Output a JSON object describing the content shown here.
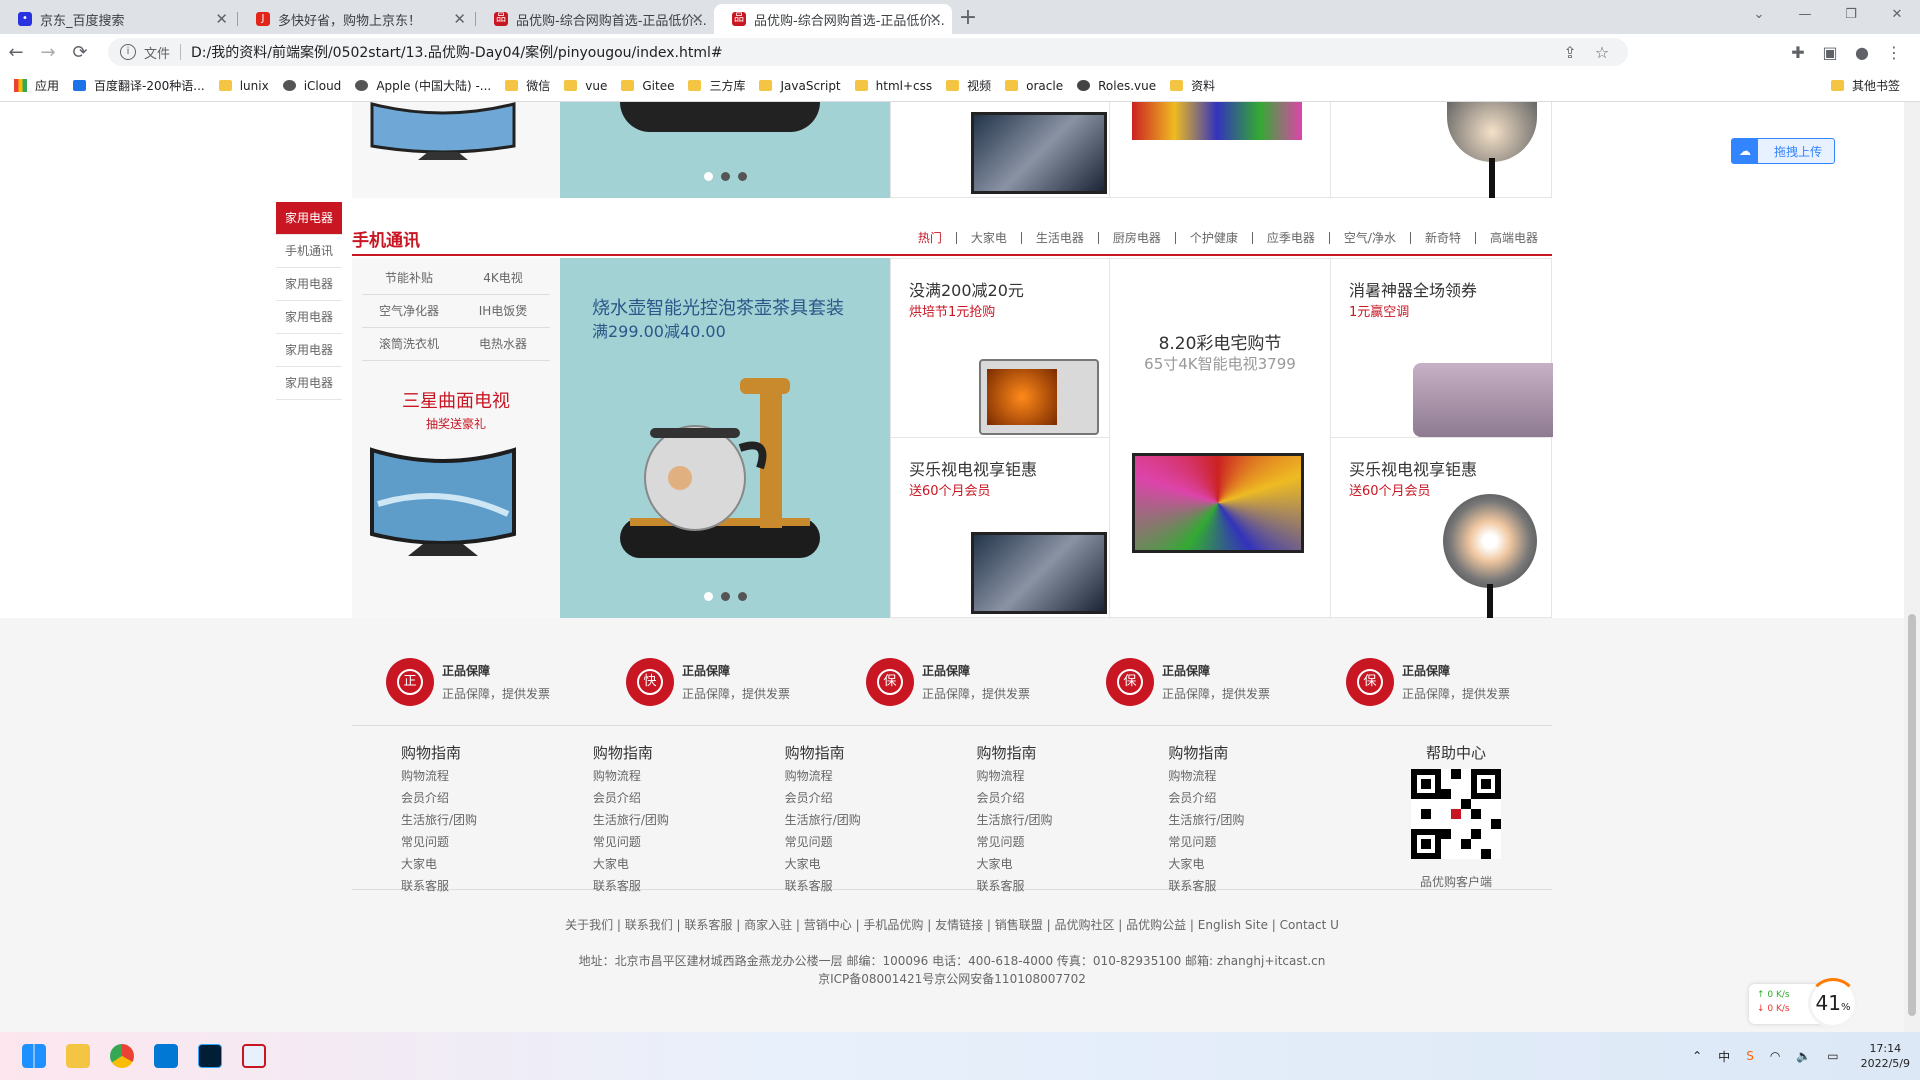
{
  "browser": {
    "tabs": [
      {
        "title": "京东_百度搜索",
        "favicon_color": "#2932e1"
      },
      {
        "title": "多快好省，购物上京东！",
        "favicon_color": "#e1251b"
      },
      {
        "title": "品优购-综合网购首选-正品低价...",
        "favicon_color": "#c81623"
      },
      {
        "title": "品优购-综合网购首选-正品低价...",
        "favicon_color": "#c81623"
      }
    ],
    "new_tab": "+",
    "address_label": "文件",
    "url": "D:/我的资料/前端案例/0502start/13.品优购-Day04/案例/pinyougou/index.html#",
    "bookmarks": [
      "应用",
      "百度翻译-200种语...",
      "lunix",
      "iCloud",
      "Apple (中国大陆) -...",
      "微信",
      "vue",
      "Gitee",
      "三方库",
      "JavaScript",
      "html+css",
      "视频",
      "oracle",
      "Roles.vue",
      "资料"
    ],
    "other_bookmarks": "其他书签"
  },
  "upload_widget": {
    "label": "拖拽上传"
  },
  "floor": {
    "side_nav": [
      "家用电器",
      "手机通讯",
      "家用电器",
      "家用电器",
      "家用电器",
      "家用电器"
    ],
    "title": "手机通讯",
    "tabs": [
      "热门",
      "大家电",
      "生活电器",
      "厨房电器",
      "个护健康",
      "应季电器",
      "空气/净水",
      "新奇特",
      "高端电器"
    ],
    "categories": [
      "节能补贴",
      "4K电视",
      "空气净化器",
      "IH电饭煲",
      "滚筒洗衣机",
      "电热水器"
    ],
    "promo_title": "三星曲面电视",
    "promo_sub": "抽奖送豪礼",
    "banner_title": "烧水壶智能光控泡茶壶茶具套装",
    "banner_price": "满299.00减40.00",
    "cells": [
      {
        "h": "没满200减20元",
        "s": "烘培节1元抢购"
      },
      {
        "h": "买乐视电视享钜惠",
        "s": "送60个月会员"
      },
      {
        "h": "8.20彩电宅购节",
        "s": "65寸4K智能电视3799"
      },
      {
        "h": "消暑神器全场领券",
        "s": "1元赢空调"
      },
      {
        "h": "买乐视电视享钜惠",
        "s": "送60个月会员"
      }
    ]
  },
  "footer": {
    "services": [
      {
        "icon": "正",
        "title": "正品保障",
        "desc": "正品保障，提供发票"
      },
      {
        "icon": "快",
        "title": "正品保障",
        "desc": "正品保障，提供发票"
      },
      {
        "icon": "保",
        "title": "正品保障",
        "desc": "正品保障，提供发票"
      },
      {
        "icon": "保",
        "title": "正品保障",
        "desc": "正品保障，提供发票"
      },
      {
        "icon": "保",
        "title": "正品保障",
        "desc": "正品保障，提供发票"
      }
    ],
    "help_cols": [
      {
        "title": "购物指南",
        "items": [
          "购物流程",
          "会员介绍",
          "生活旅行/团购",
          "常见问题",
          "大家电",
          "联系客服"
        ]
      },
      {
        "title": "购物指南",
        "items": [
          "购物流程",
          "会员介绍",
          "生活旅行/团购",
          "常见问题",
          "大家电",
          "联系客服"
        ]
      },
      {
        "title": "购物指南",
        "items": [
          "购物流程",
          "会员介绍",
          "生活旅行/团购",
          "常见问题",
          "大家电",
          "联系客服"
        ]
      },
      {
        "title": "购物指南",
        "items": [
          "购物流程",
          "会员介绍",
          "生活旅行/团购",
          "常见问题",
          "大家电",
          "联系客服"
        ]
      },
      {
        "title": "购物指南",
        "items": [
          "购物流程",
          "会员介绍",
          "生活旅行/团购",
          "常见问题",
          "大家电",
          "联系客服"
        ]
      }
    ],
    "help_center": {
      "title": "帮助中心",
      "caption": "品优购客户端"
    },
    "links": "关于我们 | 联系我们 | 联系客服 | 商家入驻 | 营销中心 | 手机品优购 | 友情链接 | 销售联盟 | 品优购社区 | 品优购公益 | English Site | Contact U",
    "address": "地址：北京市昌平区建材城西路金燕龙办公楼一层 邮编：100096 电话：400-618-4000 传真：010-82935100 邮箱: zhanghj+itcast.cn",
    "icp": "京ICP备08001421号京公网安备110108007702"
  },
  "netmon": {
    "up": "0 K/s",
    "down": "0 K/s",
    "cpu": "41",
    "cpu_unit": "%"
  },
  "taskbar": {
    "time": "17:14",
    "date": "2022/5/9",
    "ime": "中"
  },
  "colors": {
    "brand": "#c81623",
    "banner_bg": "#a3d2d5"
  }
}
